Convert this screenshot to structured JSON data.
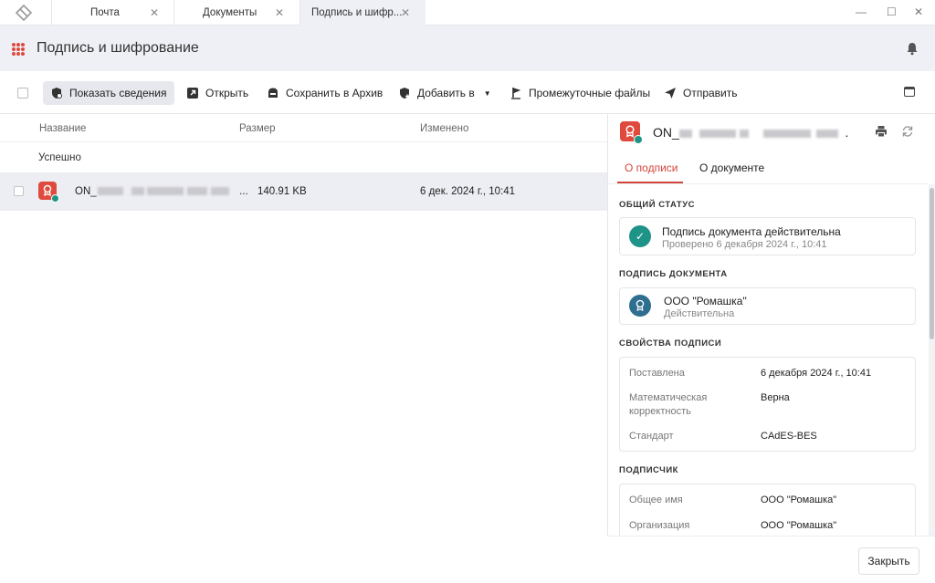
{
  "tabs": [
    {
      "label": "Почта",
      "active": false
    },
    {
      "label": "Документы",
      "active": false
    },
    {
      "label": "Подпись и шифр...",
      "active": true
    }
  ],
  "header": {
    "title": "Подпись и шифрование"
  },
  "toolbar": {
    "show_details": "Показать сведения",
    "open": "Открыть",
    "save_archive": "Сохранить в Архив",
    "add_to": "Добавить в",
    "intermediate_files": "Промежуточные файлы",
    "send": "Отправить"
  },
  "list": {
    "columns": {
      "name": "Название",
      "size": "Размер",
      "modified": "Изменено"
    },
    "group": "Успешно",
    "rows": [
      {
        "name_prefix": "ON_",
        "name_suffix": "...",
        "size": "140.91 KB",
        "modified": "6 дек. 2024 г., 10:41"
      }
    ]
  },
  "panel": {
    "doc_title_prefix": "ON_",
    "doc_title_suffix": ".",
    "tabs": {
      "signature": "О подписи",
      "document": "О документе"
    },
    "general_status": {
      "title": "ОБЩИЙ СТАТУС",
      "main": "Подпись документа действительна",
      "sub": "Проверено 6 декабря 2024 г., 10:41"
    },
    "doc_signature": {
      "title": "ПОДПИСЬ ДОКУМЕНТА",
      "main": "ООО \"Ромашка\"",
      "sub": "Действительна"
    },
    "sig_props": {
      "title": "СВОЙСТВА ПОДПИСИ",
      "rows": [
        {
          "k": "Поставлена",
          "v": "6 декабря 2024 г., 10:41"
        },
        {
          "k": "Математическая корректность",
          "v": "Верна"
        },
        {
          "k": "Стандарт",
          "v": "CAdES-BES"
        }
      ]
    },
    "signer": {
      "title": "ПОДПИСЧИК",
      "rows": [
        {
          "k": "Общее имя",
          "v": "ООО \"Ромашка\""
        },
        {
          "k": "Организация",
          "v": "ООО \"Ромашка\""
        }
      ]
    },
    "close": "Закрыть"
  },
  "colors": {
    "accent": "#d4453b",
    "brand_red": "#e0493d",
    "ok_green": "#1e9387",
    "signer_blue": "#2e6e8e",
    "header_bg": "#eef0f6"
  }
}
